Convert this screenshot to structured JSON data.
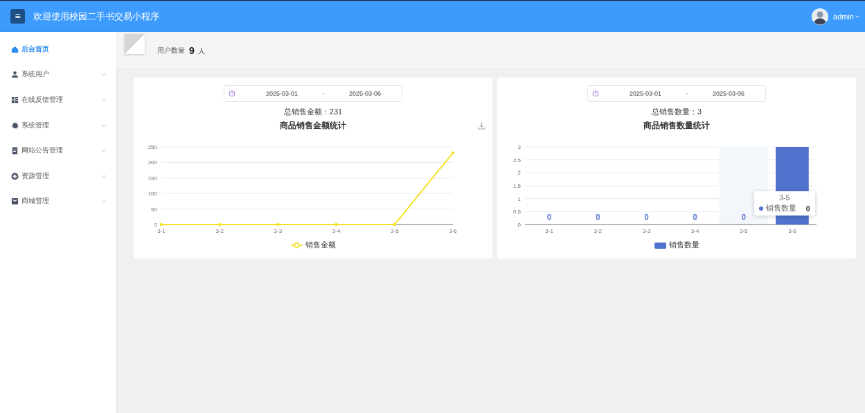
{
  "header": {
    "menu_icon": "≡",
    "title": "欢迎使用校园二手书交易小程序",
    "user": "admin"
  },
  "sidebar": {
    "items": [
      {
        "label": "后台首页",
        "selected": true,
        "has_submenu": false
      },
      {
        "label": "系统用户",
        "selected": false,
        "has_submenu": true
      },
      {
        "label": "在线反馈管理",
        "selected": false,
        "has_submenu": true
      },
      {
        "label": "系统管理",
        "selected": false,
        "has_submenu": true
      },
      {
        "label": "网站公告管理",
        "selected": false,
        "has_submenu": true
      },
      {
        "label": "资源管理",
        "selected": false,
        "has_submenu": true
      },
      {
        "label": "商城管理",
        "selected": false,
        "has_submenu": true
      }
    ]
  },
  "stats": {
    "label": "用户数量",
    "value": "9",
    "unit": "人"
  },
  "panels": [
    {
      "date_range": {
        "start": "2025-03-01",
        "separator": "-",
        "end": "2025-03-06"
      },
      "total_label": "总销售金额：",
      "total": "231",
      "has_download": true,
      "chart_data": {
        "type": "line",
        "title": "商品销售金额统计",
        "categories": [
          "3-1",
          "3-2",
          "3-3",
          "3-4",
          "3-5",
          "3-6"
        ],
        "series": [
          {
            "name": "销售金额",
            "color": "#f5e12a",
            "values": [
              0,
              0,
              0,
              0,
              0,
              231
            ]
          }
        ],
        "ylim": [
          0,
          250
        ],
        "yticks": [
          0,
          50,
          100,
          150,
          200,
          250
        ],
        "grid": true
      }
    },
    {
      "date_range": {
        "start": "2025-03-01",
        "separator": "-",
        "end": "2025-03-06"
      },
      "total_label": "总销售数量：",
      "total": "3",
      "has_download": false,
      "chart_data": {
        "type": "bar",
        "title": "商品销售数量统计",
        "categories": [
          "3-1",
          "3-2",
          "3-3",
          "3-4",
          "3-5",
          "3-6"
        ],
        "series": [
          {
            "name": "销售数量",
            "color": "#5072cc",
            "values": [
              0,
              0,
              0,
              0,
              0,
              3
            ],
            "value_labels": [
              "0",
              "0",
              "0",
              "0",
              "0",
              null
            ]
          }
        ],
        "ylim": [
          0,
          3
        ],
        "yticks": [
          0,
          0.5,
          1,
          1.5,
          2,
          2.5,
          3
        ],
        "grid": true,
        "bands": [
          {
            "axis": "x",
            "from": "3-5",
            "to": "3-5"
          }
        ]
      },
      "tooltip": {
        "title": "3-5",
        "series": "销售数量",
        "value": "0"
      }
    }
  ]
}
